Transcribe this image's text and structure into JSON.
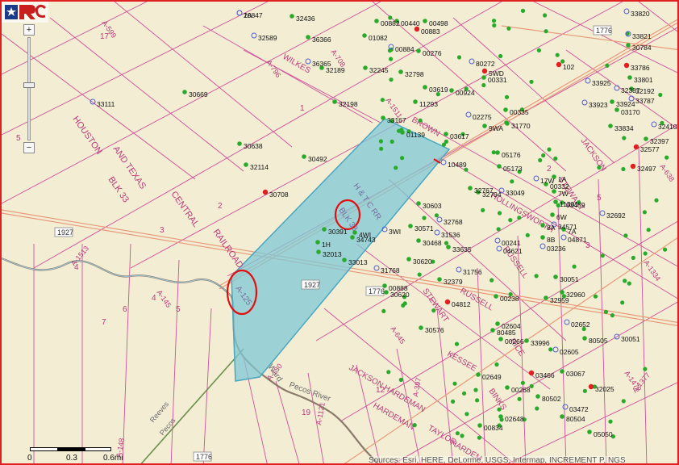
{
  "map": {
    "highways": [
      "1776",
      "1927"
    ],
    "scale": {
      "labels": [
        "0",
        "0.3",
        "0.6mi"
      ]
    },
    "attribution": "Sources: Esri, HERE, DeLorme, USGS, Intermap, INCREMENT P, NGS",
    "labels": {
      "houston": "HOUSTON",
      "and_texas": "AND   TEXAS",
      "central": "CENTRAL",
      "railroad": "RAILROAD",
      "blk33": "BLK 33",
      "htcrr": "H & T C RR",
      "blk33_red": "BLK 33",
      "a125": "A-125",
      "wilkes": "WILKES",
      "brown": "BROWN",
      "stewart1": "STEWART",
      "stewart2": "STEWART",
      "jackson1": "JACKSON",
      "jackson2": "JACKSON HARDEMAN",
      "hardeman": "HARDEMAN",
      "taylor": "TAYLOR",
      "hardem": "HARDEM",
      "kessee": "KESSEE",
      "binks": "BINKS",
      "rice": "RICE",
      "russell1": "RUSSELL",
      "russell2": "RUSSELL",
      "hollingsworth": "HOLLINGSWORTH",
      "pecos_river": "Pecos River",
      "reeves": "Reeves",
      "pecos": "Pecos",
      "ward": "Ward",
      "a599": "A-599",
      "a708": "A-708",
      "a796": "A-796",
      "a1511": "A-1511",
      "a1513": "A-1513",
      "a145": "A-145",
      "a148": "A-148",
      "a1121": "A-1121",
      "a130": "A-130",
      "a645": "A-645",
      "a1334": "A-1334",
      "a638": "A-638",
      "a1478": "A-1478",
      "a1377": "A-1377",
      "a397": "A-397"
    },
    "section_numbers": [
      "17",
      "5",
      "4",
      "3",
      "2",
      "1",
      "6",
      "7",
      "5",
      "4",
      "12",
      "19",
      "5",
      "3",
      "2"
    ],
    "well_labels": [
      "10847",
      "32589",
      "32436",
      "36366",
      "36365",
      "32189",
      "32198",
      "30669",
      "33111",
      "30638",
      "32114",
      "30708",
      "30492",
      "30391",
      "34743",
      "32013",
      "33013",
      "31768",
      "30620",
      "30576",
      "30603",
      "32768",
      "30571",
      "31536",
      "30468",
      "33635",
      "33167",
      "01139",
      "10489",
      "32245",
      "32798",
      "00882",
      "00440",
      "00498",
      "00883",
      "01082",
      "00884",
      "00276",
      "80272",
      "00331",
      "00924",
      "03619",
      "11293",
      "02275",
      "03617",
      "05176",
      "05173",
      "32767",
      "33049",
      "11301",
      "03459",
      "34571",
      "04871",
      "03236",
      "04621",
      "00241",
      "31756",
      "32379",
      "00238",
      "04812",
      "80485",
      "00266",
      "33996",
      "02604",
      "02605",
      "02652",
      "80505",
      "30051",
      "03466",
      "02649",
      "00268",
      "80502",
      "03067",
      "32025",
      "80504",
      "03472",
      "05050",
      "02648",
      "00834",
      "33820",
      "33821",
      "30784",
      "33786",
      "33801",
      "33925",
      "33923",
      "33924",
      "33787",
      "32192",
      "32410",
      "33834",
      "32577",
      "32397",
      "32497",
      "03170",
      "32387",
      "32692",
      "30051",
      "32960",
      "32959",
      "32794",
      "31770",
      "00335",
      "00332",
      "00888",
      "30620",
      "3WI",
      "4WI",
      "1H",
      "102",
      "8B",
      "7W",
      "6W",
      "8A",
      "7A",
      "9WA",
      "5WD",
      "17W",
      "1A",
      "2A"
    ]
  }
}
